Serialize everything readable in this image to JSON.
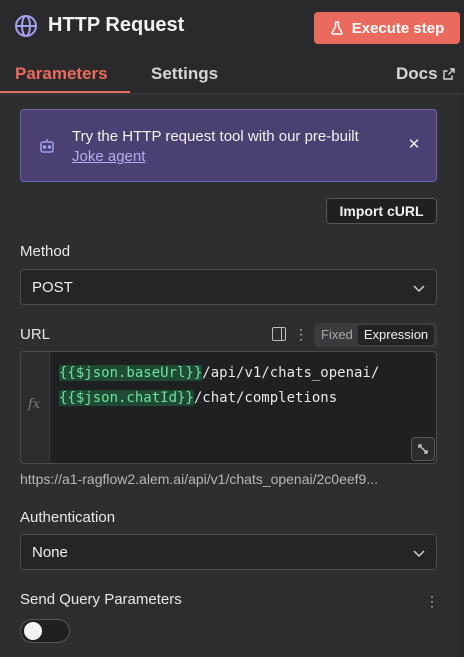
{
  "header": {
    "title": "HTTP Request",
    "execute_label": "Execute step"
  },
  "tabs": [
    {
      "label": "Parameters",
      "active": true
    },
    {
      "label": "Settings",
      "active": false
    },
    {
      "label": "Docs",
      "active": false
    }
  ],
  "callout": {
    "text": "Try the HTTP request tool with our pre-built",
    "link": "Joke agent"
  },
  "import_curl_label": "Import cURL",
  "method": {
    "label": "Method",
    "value": "POST"
  },
  "url": {
    "label": "URL",
    "mode_fixed": "Fixed",
    "mode_expression": "Expression",
    "fx": "fx",
    "line1_expr": "{{$json.baseUrl}}",
    "line1_text": "/api/v1/chats_openai/",
    "line2_expr": "{{$json.chatId}}",
    "line2_text": "/chat/completions",
    "resolved": "https://a1-ragflow2.alem.ai/api/v1/chats_openai/2c0eef9..."
  },
  "authentication": {
    "label": "Authentication",
    "value": "None"
  },
  "send_query": {
    "label": "Send Query Parameters",
    "enabled": false
  },
  "colors": {
    "accent": "#ea6b5d",
    "callout_bg": "#4a4172",
    "expression_green": "#6fe2a1"
  }
}
